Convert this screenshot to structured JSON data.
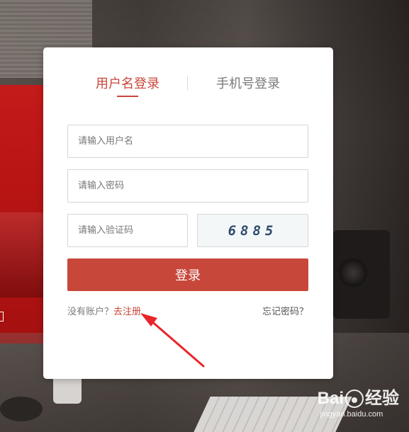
{
  "tabs": {
    "username_login": "用户名登录",
    "phone_login": "手机号登录"
  },
  "form": {
    "username_placeholder": "请输入用户名",
    "password_placeholder": "请输入密码",
    "captcha_placeholder": "请输入验证码",
    "captcha_text": "6885",
    "login_button": "登录"
  },
  "footer": {
    "no_account_text": "没有账户？",
    "register_link": "去注册",
    "forgot_password": "忘记密码？"
  },
  "watermark": {
    "logo_text": "Bai",
    "logo_suffix": "经验",
    "url": "jingyan.baidu.com"
  },
  "colors": {
    "accent": "#c8473b",
    "annotation_arrow": "#e8262a"
  }
}
